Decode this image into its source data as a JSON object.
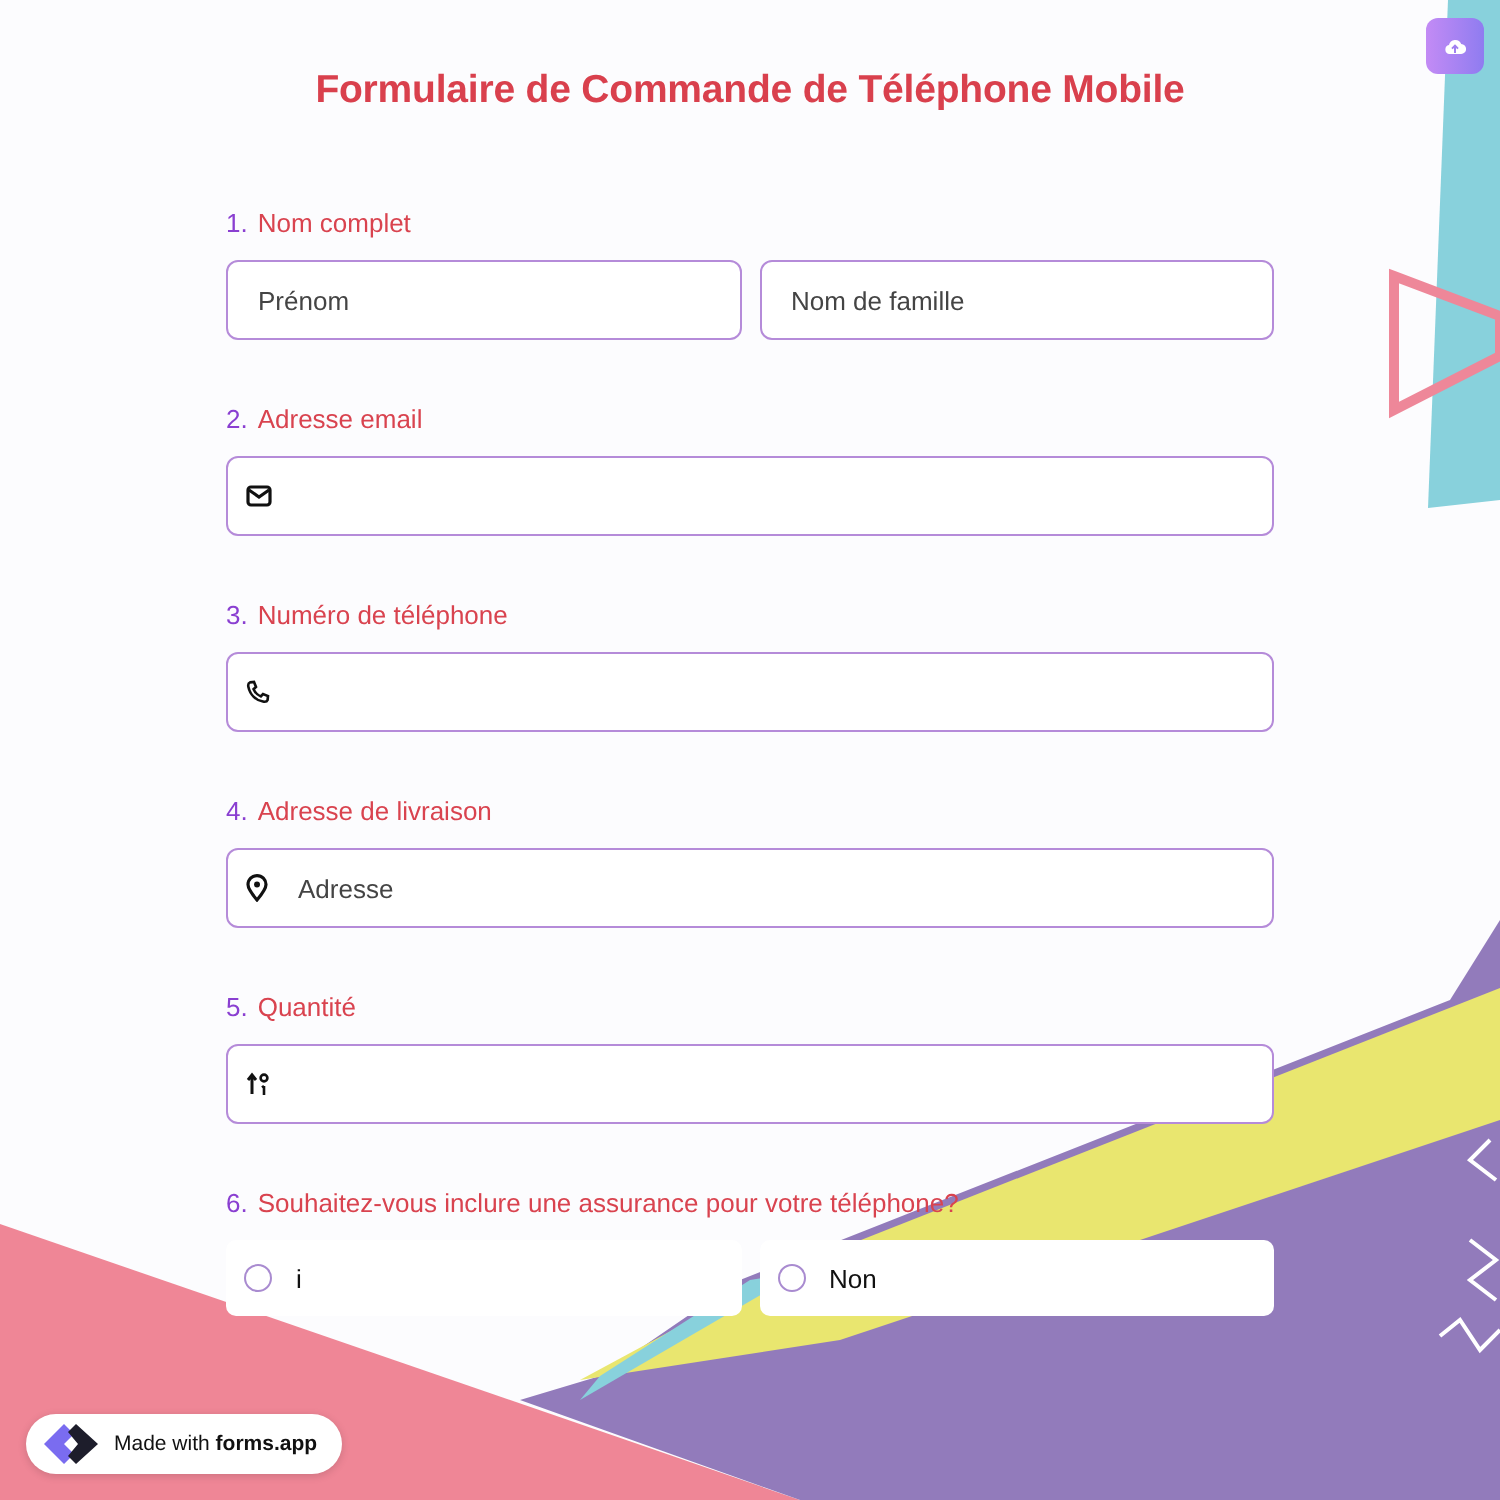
{
  "title": "Formulaire de Commande de Téléphone Mobile",
  "questions": [
    {
      "number": "1.",
      "label": "Nom complet",
      "kind": "name",
      "fields": [
        {
          "placeholder": "Prénom"
        },
        {
          "placeholder": "Nom de famille"
        }
      ]
    },
    {
      "number": "2.",
      "label": "Adresse email",
      "kind": "email"
    },
    {
      "number": "3.",
      "label": "Numéro de téléphone",
      "kind": "phone"
    },
    {
      "number": "4.",
      "label": "Adresse de livraison",
      "kind": "address",
      "fields": [
        {
          "placeholder": "Adresse"
        }
      ]
    },
    {
      "number": "5.",
      "label": "Quantité",
      "kind": "quantity"
    },
    {
      "number": "6.",
      "label": "Souhaitez-vous inclure une assurance pour votre téléphone?",
      "kind": "choice",
      "options": [
        {
          "label": "i",
          "selected": false
        },
        {
          "label": "Non",
          "selected": false
        }
      ]
    }
  ],
  "badge": "Made with **forms.app**"
}
